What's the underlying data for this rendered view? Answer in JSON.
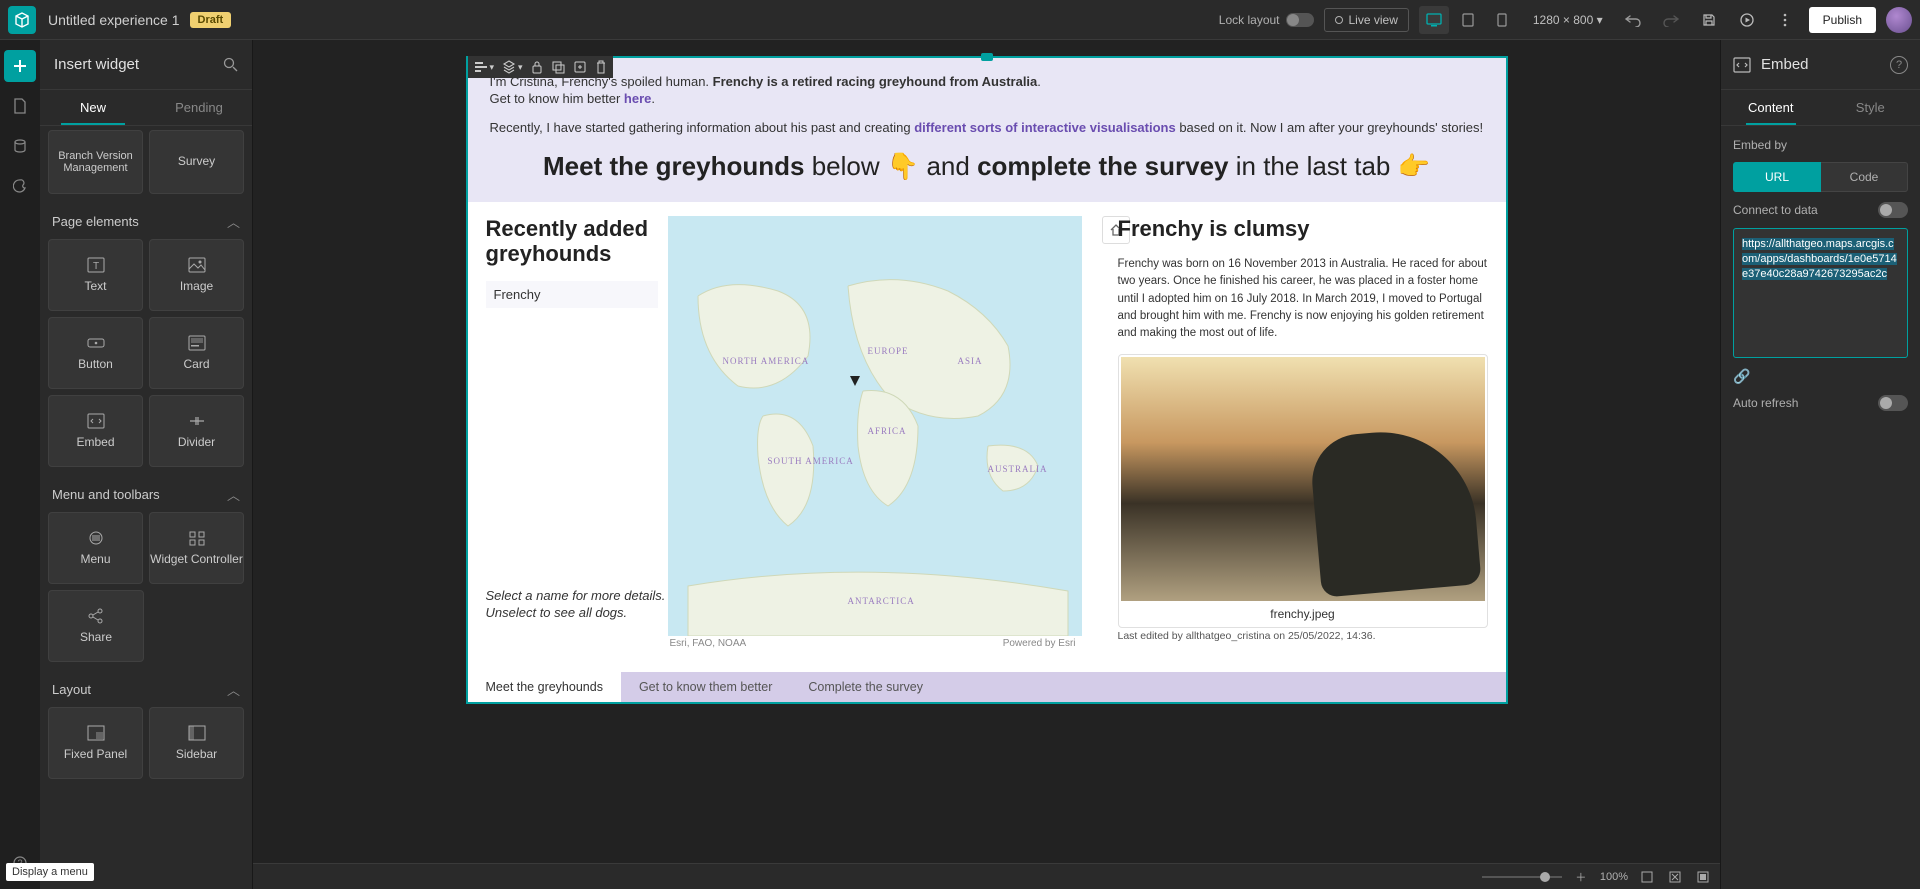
{
  "topbar": {
    "title": "Untitled experience 1",
    "draft": "Draft",
    "lock_layout": "Lock layout",
    "live_view": "Live view",
    "size": "1280 × 800",
    "publish": "Publish"
  },
  "leftPanel": {
    "title": "Insert widget",
    "tab_new": "New",
    "tab_pending": "Pending",
    "row0_left": "Branch Version Management",
    "row0_right": "Survey",
    "sec_page": "Page elements",
    "widgets_page": {
      "text": "Text",
      "image": "Image",
      "button": "Button",
      "card": "Card",
      "embed": "Embed",
      "divider": "Divider"
    },
    "sec_menu": "Menu and toolbars",
    "widgets_menu": {
      "menu": "Menu",
      "widget_controller": "Widget Controller",
      "share": "Share"
    },
    "sec_layout": "Layout",
    "widgets_layout": {
      "fixed_panel": "Fixed Panel",
      "sidebar": "Sidebar"
    },
    "tooltip": "Display a menu"
  },
  "canvas": {
    "intro1_a": "I'm Cristina, Frenchy's spoiled human. ",
    "intro1_b": "Frenchy is a retired racing greyhound from Australia",
    "intro2_a": "Get to know him better ",
    "intro2_link": "here",
    "recently_a": "Recently, I have started gathering information about his past and creating ",
    "recently_link": "different sorts of interactive visualisations",
    "recently_b": " based on it. Now I am after your greyhounds' stories!",
    "hero_a": "Meet the greyhounds",
    "hero_b": " below ",
    "hero_emoji1": "👇",
    "hero_c": "and ",
    "hero_d": "complete the survey",
    "hero_e": " in the last tab ",
    "hero_emoji2": "👉",
    "left_heading": "Recently added greyhounds",
    "list_item": "Frenchy",
    "select_hint1": "Select a name for more details.",
    "select_hint2": "Unselect to see all dogs.",
    "map_esri": "Esri, FAO, NOAA",
    "map_powered": "Powered by Esri",
    "map_labels": {
      "na": "NORTH AMERICA",
      "sa": "SOUTH AMERICA",
      "eu": "EUROPE",
      "af": "AFRICA",
      "as": "ASIA",
      "au": "AUSTRALIA",
      "an": "ANTARCTICA"
    },
    "right_heading": "Frenchy is clumsy",
    "story": "Frenchy was born on 16 November 2013 in Australia. He raced for about two years. Once he finished his career, he was placed in a foster home until I adopted him on 16 July 2018. In March 2019, I moved to Portugal and brought him with me. Frenchy is now enjoying his golden retirement and making the most out of life.",
    "photo_name": "frenchy.jpeg",
    "last_edit": "Last edited by allthatgeo_cristina on 25/05/2022, 14:36.",
    "tab1": "Meet the greyhounds",
    "tab2": "Get to know them better",
    "tab3": "Complete the survey"
  },
  "rightPanel": {
    "title": "Embed",
    "tab_content": "Content",
    "tab_style": "Style",
    "embed_by": "Embed by",
    "url": "URL",
    "code": "Code",
    "connect": "Connect to data",
    "url_value": "https://allthatgeo.maps.arcgis.com/apps/dashboards/1e0e5714e37e40c28a9742673295ac2c",
    "auto_refresh": "Auto refresh"
  },
  "statusbar": {
    "zoom": "100%"
  }
}
